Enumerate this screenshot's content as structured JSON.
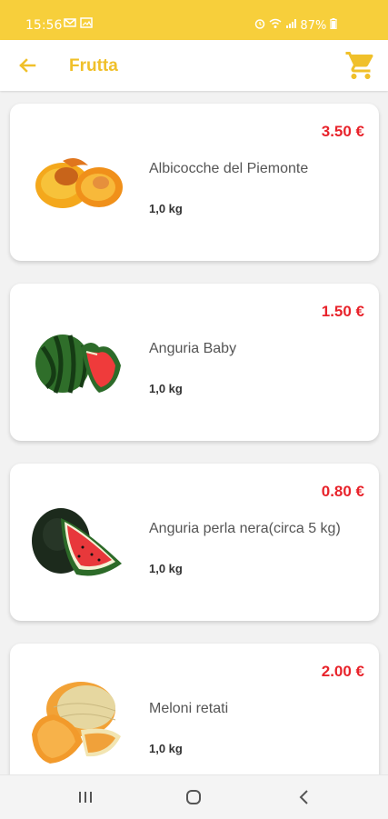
{
  "status": {
    "time": "15:56",
    "battery": "87%"
  },
  "header": {
    "title": "Frutta",
    "back_icon": "arrow-back-icon",
    "cart_icon": "shopping-cart-icon",
    "accent": "#f0c02a"
  },
  "products": [
    {
      "name": "Albicocche del Piemonte",
      "weight": "1,0 kg",
      "price": "3.50 €",
      "image": "apricot"
    },
    {
      "name": "Anguria Baby",
      "weight": "1,0 kg",
      "price": "1.50 €",
      "image": "watermelon"
    },
    {
      "name": "Anguria perla nera(circa 5 kg)",
      "weight": "1,0 kg",
      "price": "0.80 €",
      "image": "watermelon-slice"
    },
    {
      "name": "Meloni retati",
      "weight": "1,0 kg",
      "price": "2.00 €",
      "image": "cantaloupe"
    }
  ],
  "colors": {
    "status_bar": "#f7cf3b",
    "price": "#e8232b"
  },
  "nav": {
    "recent_icon": "recent-apps-icon",
    "home_icon": "home-icon",
    "back_icon": "nav-back-icon"
  }
}
